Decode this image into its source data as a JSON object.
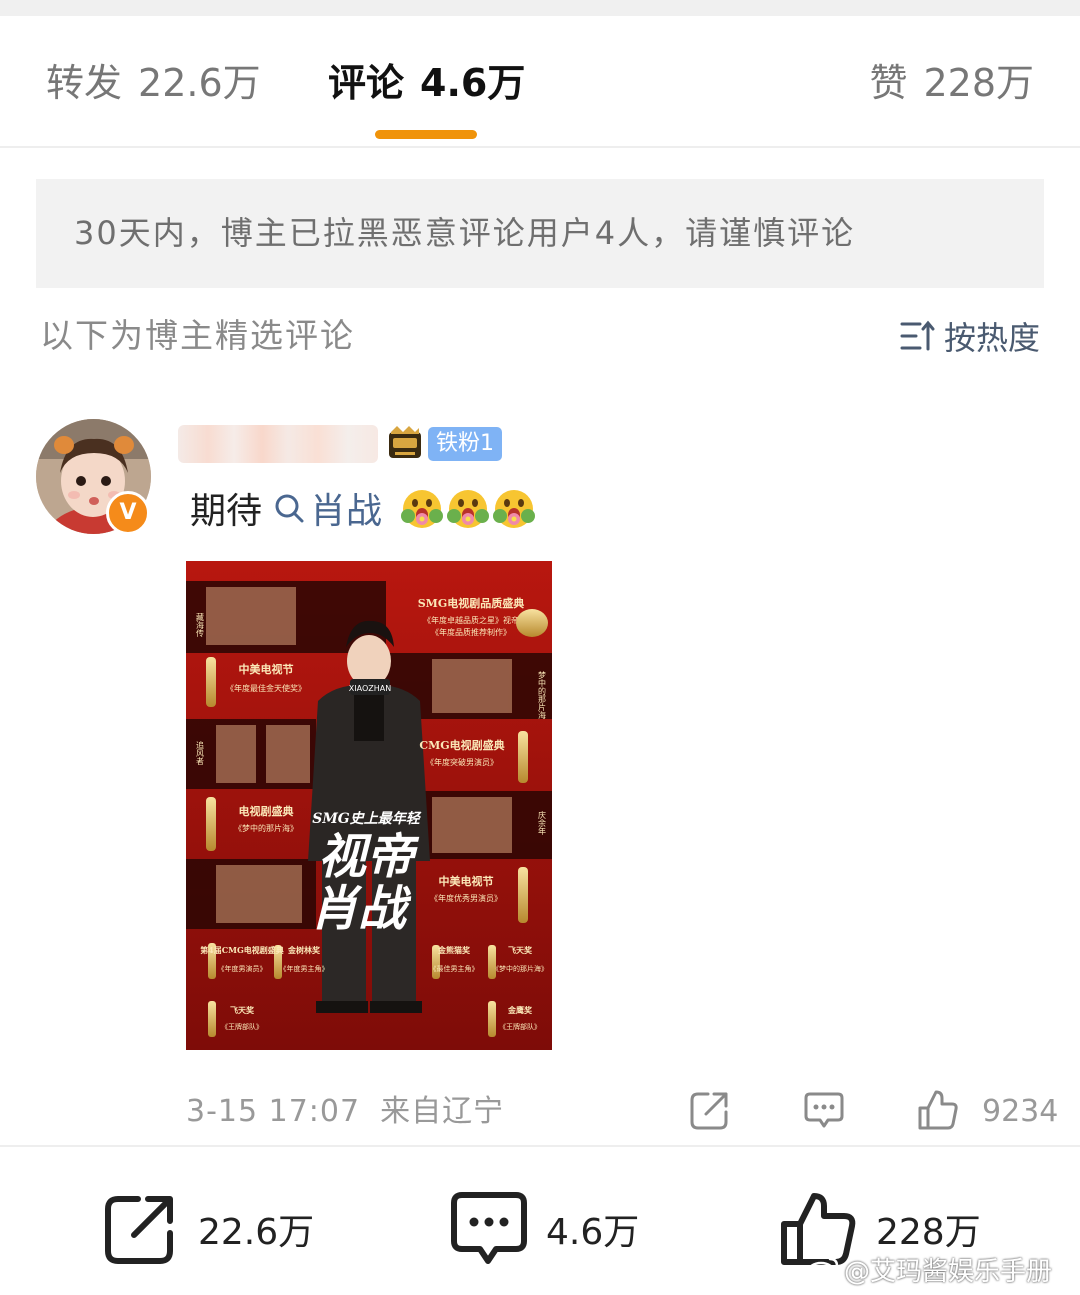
{
  "tabs": {
    "repost": {
      "label": "转发",
      "count": "22.6万"
    },
    "comments": {
      "label": "评论",
      "count": "4.6万"
    },
    "likes": {
      "label": "赞",
      "count": "228万"
    }
  },
  "notice": "30天内，博主已拉黑恶意评论用户4人，请谨慎评论",
  "subhead": "以下为博主精选评论",
  "sort_label": "按热度",
  "comment": {
    "fan_badge": "铁粉1",
    "avatar_badge": "V",
    "text": "期待",
    "mention": "肖战",
    "timestamp": "3-15 17:07",
    "location": "来自辽宁",
    "like_count": "9234"
  },
  "poster": {
    "top_title": "SMG电视剧品质盛典",
    "top_sub1": "《年度卓越品质之星》视帝",
    "top_sub2": "《年度品质推荐制作》",
    "award1": "中美电视节",
    "award1_sub": "《年度最佳金天使奖》",
    "award2": "CMG电视剧盛典",
    "award2_sub": "《年度突破男演员》",
    "award3": "电视剧盛典",
    "award3_sub": "《梦中的那片海》",
    "award4": "中美电视节",
    "award4_sub": "《年度优秀男演员》",
    "headline_small": "SMG史上最年轻",
    "headline_big_1": "视帝",
    "headline_big_2": "肖战",
    "mic_text": "XIAOZHAN",
    "bottom_awards": [
      "第4届CMG电视剧盛典",
      "金树林奖",
      "金熊猫奖",
      "飞天奖",
      "金鹰奖"
    ],
    "bottom_subs": [
      "《年度男演员》",
      "《年度男主角》",
      "《梦中的那片海》",
      "《王牌部队》",
      "《王牌部队》",
      "《最佳男主角》"
    ],
    "side_titles": [
      "藏海传",
      "梦中的那片海",
      "追风者",
      "庆余年"
    ]
  },
  "bottom_bar": {
    "repost_count": "22.6万",
    "comment_count": "4.6万",
    "like_count": "228万"
  },
  "watermark": "@艾玛酱娱乐手册",
  "colors": {
    "accent": "#f0930a",
    "link": "#4a6790",
    "fan_badge": "#7fb3f5",
    "verified": "#f58b1a",
    "poster_red": "#a8140f"
  }
}
